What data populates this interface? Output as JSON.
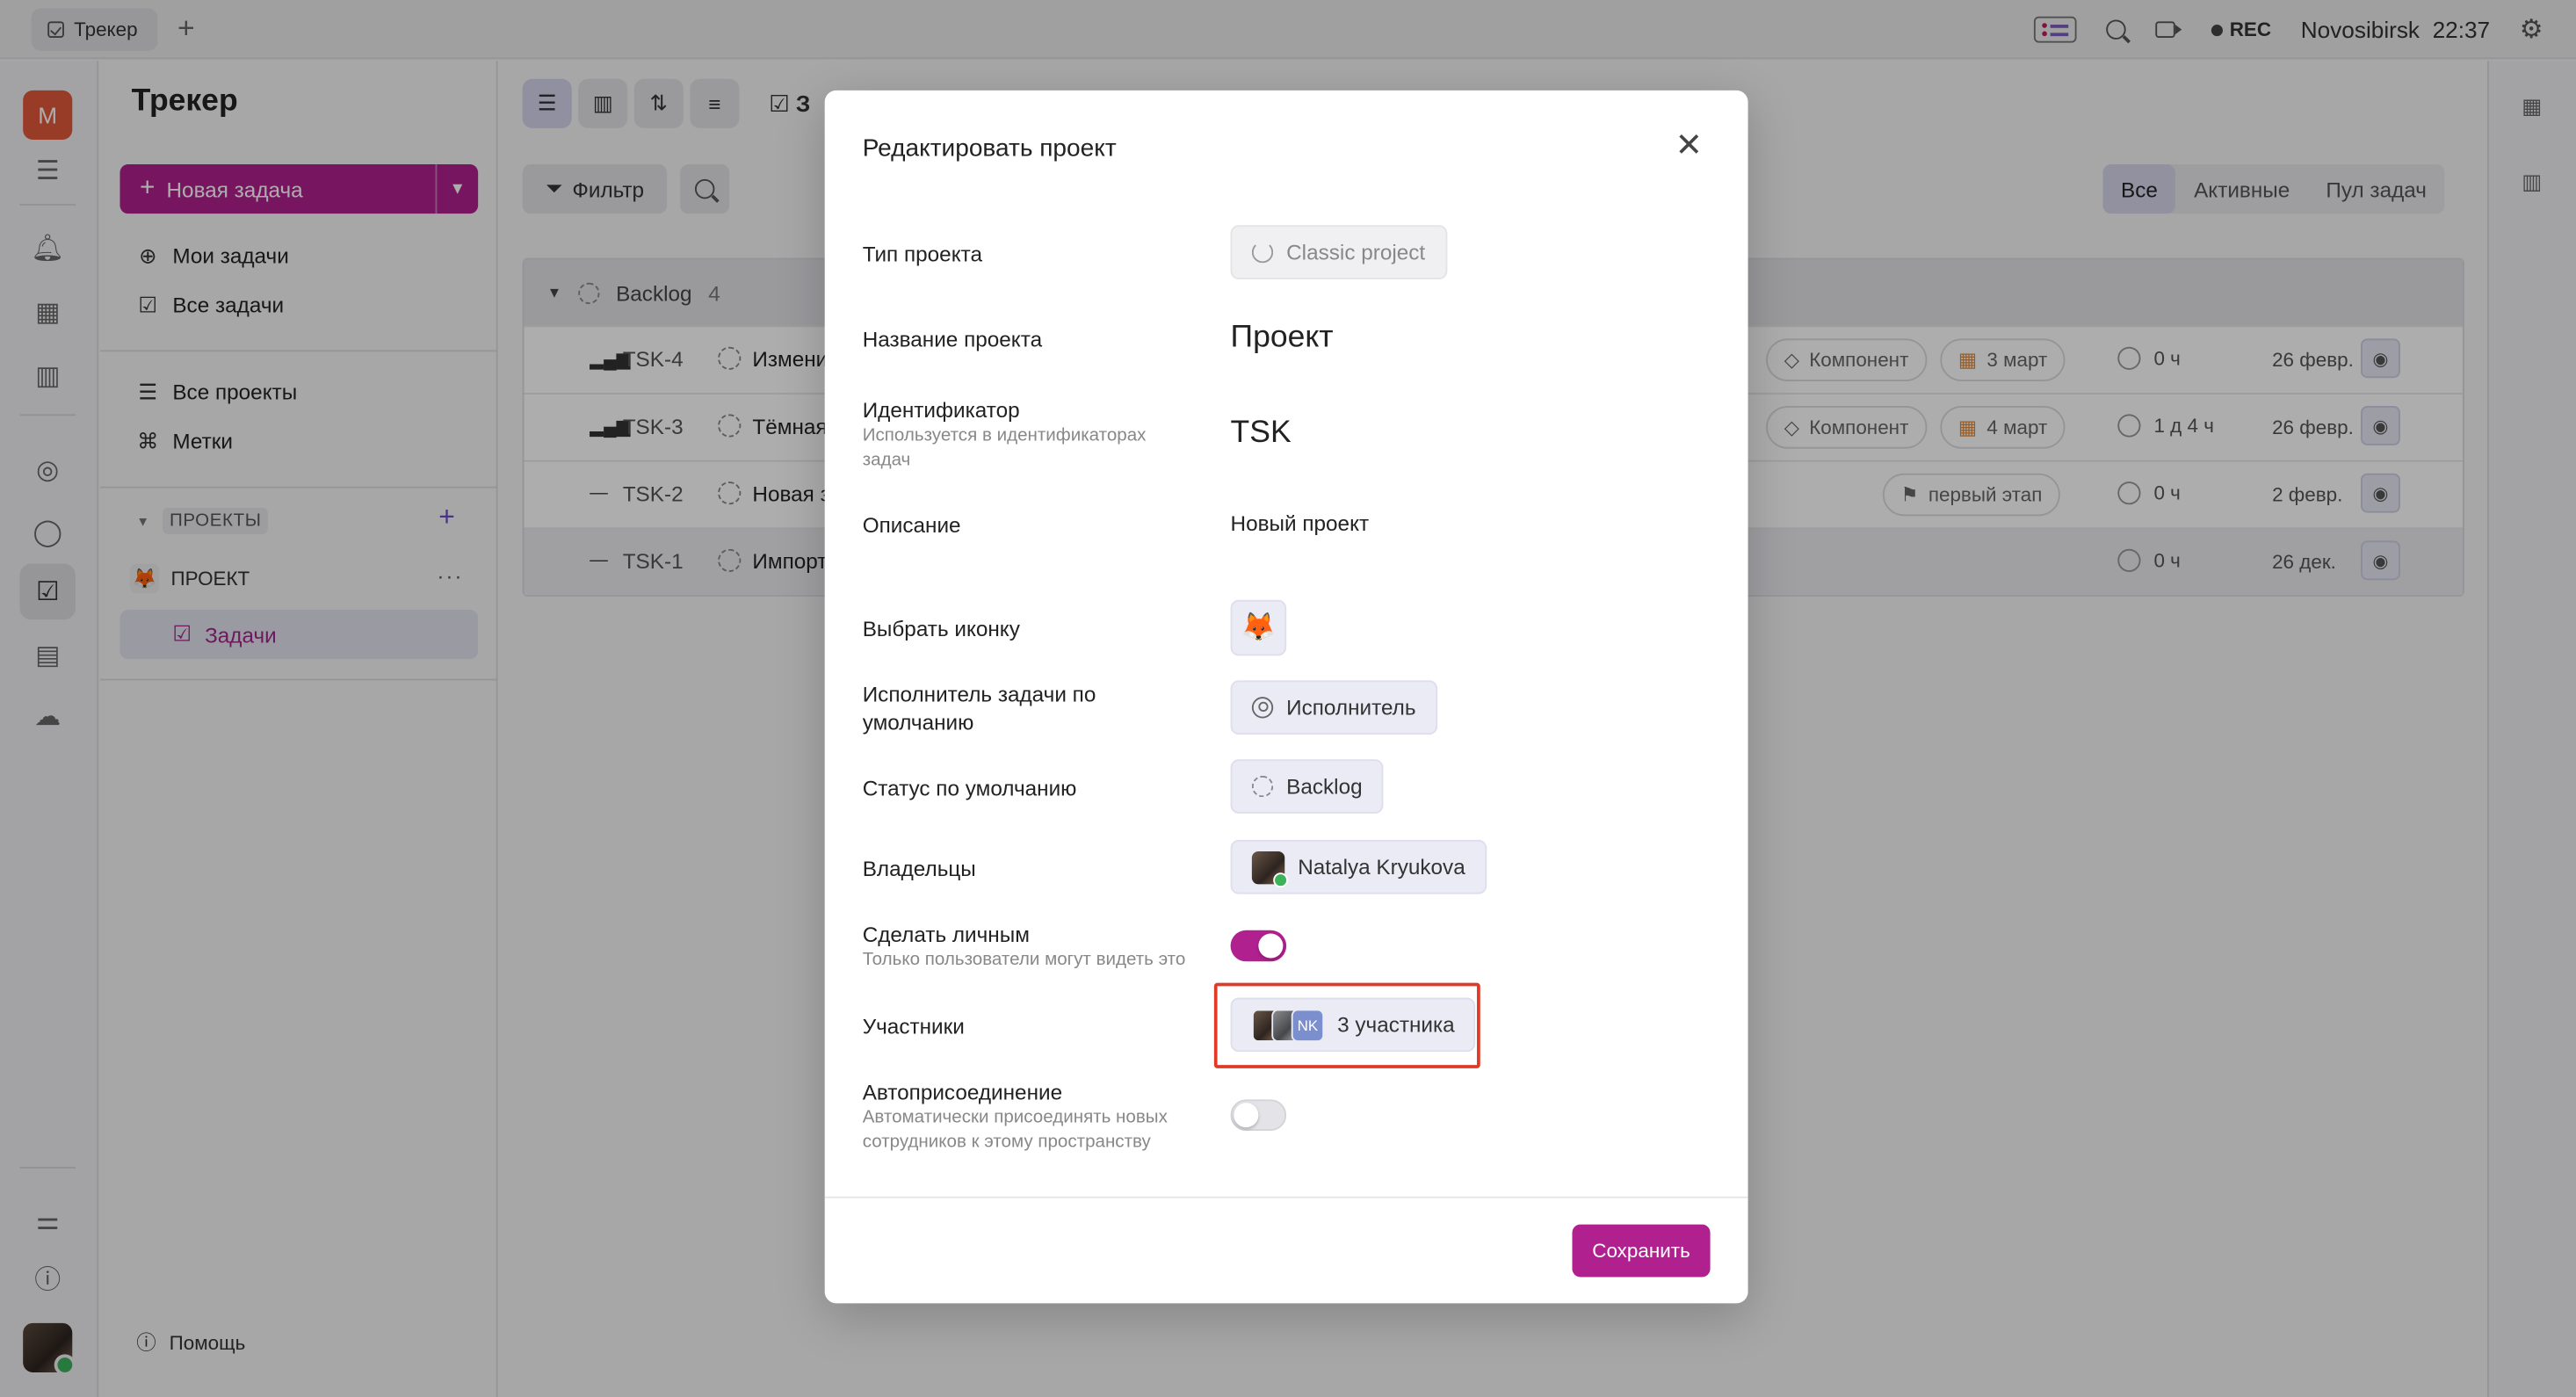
{
  "topbar": {
    "tab_label": "Трекер",
    "rec_label": "REC",
    "city": "Novosibirsk",
    "time": "22:37"
  },
  "rail": {
    "avatar_letter": "M"
  },
  "sidebar": {
    "title": "Трекер",
    "new_task_label": "Новая задача",
    "items": [
      {
        "label": "Мои задачи",
        "icon": "crosshair-icon"
      },
      {
        "label": "Все задачи",
        "icon": "checkbox-icon"
      },
      {
        "label": "Все проекты",
        "icon": "list-icon"
      },
      {
        "label": "Метки",
        "icon": "tag-icon"
      }
    ],
    "section_label": "ПРОЕКТЫ",
    "project_name": "ПРОЕКТ",
    "project_icon": "🦊",
    "active_item": "Задачи",
    "help_label": "Помощь"
  },
  "main": {
    "filter_label": "Фильтр",
    "segments": [
      "Все",
      "Активные",
      "Пул задач"
    ],
    "group": {
      "name": "Backlog",
      "count": "4"
    },
    "rows": [
      {
        "key": "TSK-4",
        "name": "Измени",
        "component": "Компонент",
        "due": "3 март",
        "time": "0 ч",
        "date": "26 февр."
      },
      {
        "key": "TSK-3",
        "name": "Тёмная",
        "component": "Компонент",
        "due": "4 март",
        "time": "1 д 4 ч",
        "date": "26 февр."
      },
      {
        "key": "TSK-2",
        "name": "Новая з",
        "milestone": "первый этап",
        "time": "0 ч",
        "date": "2 февр."
      },
      {
        "key": "TSK-1",
        "name": "Импорт",
        "time": "0 ч",
        "date": "26 дек."
      }
    ],
    "partial_header": "З"
  },
  "modal": {
    "title": "Редактировать проект",
    "fields": {
      "type_label": "Тип проекта",
      "type_value": "Classic project",
      "name_label": "Название проекта",
      "name_value": "Проект",
      "id_label": "Идентификатор",
      "id_hint": "Используется в идентификаторах задач",
      "id_value": "TSK",
      "desc_label": "Описание",
      "desc_value": "Новый проект",
      "icon_label": "Выбрать иконку",
      "icon_value": "🦊",
      "assignee_label": "Исполнитель задачи по умолчанию",
      "assignee_value": "Исполнитель",
      "status_label": "Статус по умолчанию",
      "status_value": "Backlog",
      "owners_label": "Владельцы",
      "owners_value": "Natalya Kryukova",
      "private_label": "Сделать личным",
      "private_hint": "Только пользователи могут видеть это",
      "private_on": true,
      "members_label": "Участники",
      "members_value": "3 участника",
      "members_initials": "NK",
      "autojoin_label": "Автоприсоединение",
      "autojoin_hint": "Автоматически присоединять новых сотрудников к этому пространству",
      "autojoin_on": false
    },
    "save_label": "Сохранить"
  },
  "colors": {
    "accent": "#b0208f",
    "highlight": "#e03a26",
    "avatar": "#e0593c"
  }
}
